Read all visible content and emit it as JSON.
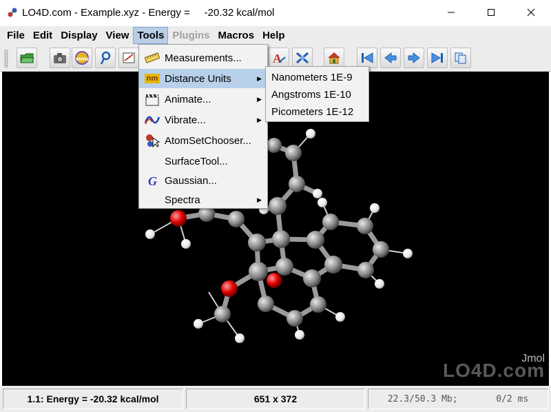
{
  "window": {
    "title": "LO4D.com - Example.xyz - Energy =     -20.32 kcal/mol",
    "icon": "jmol-app-icon",
    "controls": [
      "minimize",
      "maximize",
      "close"
    ]
  },
  "menubar": {
    "items": [
      {
        "label": "File",
        "state": "normal"
      },
      {
        "label": "Edit",
        "state": "normal"
      },
      {
        "label": "Display",
        "state": "normal"
      },
      {
        "label": "View",
        "state": "normal"
      },
      {
        "label": "Tools",
        "state": "active"
      },
      {
        "label": "Plugins",
        "state": "disabled"
      },
      {
        "label": "Macros",
        "state": "normal"
      },
      {
        "label": "Help",
        "state": "normal"
      }
    ]
  },
  "toolbar": {
    "buttons": [
      "open-folder-icon",
      "camera-icon",
      "www-export-icon",
      "script-icon",
      "editor-icon",
      "font-a-icon",
      "axes-icon",
      "home-icon",
      "first-frame-icon",
      "previous-frame-icon",
      "next-frame-icon",
      "last-frame-icon",
      "copy-frames-icon"
    ]
  },
  "tools_menu": {
    "items": [
      {
        "label": "Measurements...",
        "icon": "ruler-icon",
        "submenu": false
      },
      {
        "label": "Distance Units",
        "icon": "nm-icon",
        "icon_text": "nm",
        "submenu": true,
        "highlighted": true
      },
      {
        "label": "Animate...",
        "icon": "clapper-icon",
        "submenu": true
      },
      {
        "label": "Vibrate...",
        "icon": "wave-icon",
        "submenu": true
      },
      {
        "label": "AtomSetChooser...",
        "icon": "atomset-icon",
        "submenu": false
      },
      {
        "label": "SurfaceTool...",
        "icon": "",
        "submenu": false
      },
      {
        "label": "Gaussian...",
        "icon": "gaussian-icon",
        "submenu": false
      },
      {
        "label": "Spectra",
        "icon": "",
        "submenu": true
      }
    ]
  },
  "distance_units_submenu": {
    "items": [
      {
        "label": "Nanometers 1E-9"
      },
      {
        "label": "Angstroms 1E-10"
      },
      {
        "label": "Picometers 1E-12"
      }
    ]
  },
  "viewer": {
    "background": "#000000",
    "brand_label": "Jmol",
    "watermark": "LO4D.com"
  },
  "statusbar": {
    "energy": "1.1: Energy =     -20.32 kcal/mol",
    "dimensions": "651 x 372",
    "memory": "22.3/50.3 Mb;",
    "timing": "0/2 ms"
  },
  "colors": {
    "menu_highlight": "#b8d0ea",
    "chrome": "#ececec",
    "carbon": "#8a8a8a",
    "oxygen": "#e00000",
    "hydrogen": "#ffffff"
  }
}
